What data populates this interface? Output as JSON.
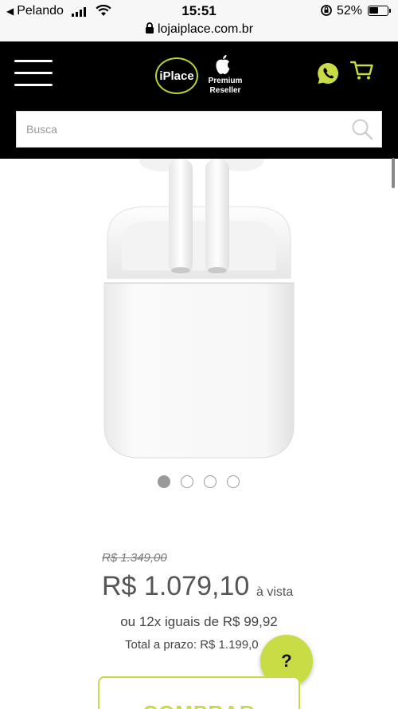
{
  "status_bar": {
    "back_label": "Pelando",
    "time": "15:51",
    "battery_percent": "52%",
    "battery_level": 0.52
  },
  "browser": {
    "url": "lojaiplace.com.br"
  },
  "header": {
    "logo_text": "iPlace",
    "reseller_line1": "Premium",
    "reseller_line2": "Reseller",
    "accent_color": "#c9dc46",
    "icons": [
      "menu-icon",
      "apple-logo-icon",
      "whatsapp-icon",
      "cart-icon",
      "search-icon"
    ]
  },
  "search": {
    "placeholder": "Busca",
    "value": ""
  },
  "gallery": {
    "slides": 4,
    "active_index": 0
  },
  "pricing": {
    "old_price": "R$ 1.349,00",
    "price": "R$ 1.079,10",
    "price_suffix": "à vista",
    "installments": "ou 12x iguais de R$ 99,92",
    "total": "Total a prazo: R$ 1.199,0"
  },
  "help_button": {
    "label": "?"
  },
  "buy_button": {
    "label": "COMPRAR"
  }
}
